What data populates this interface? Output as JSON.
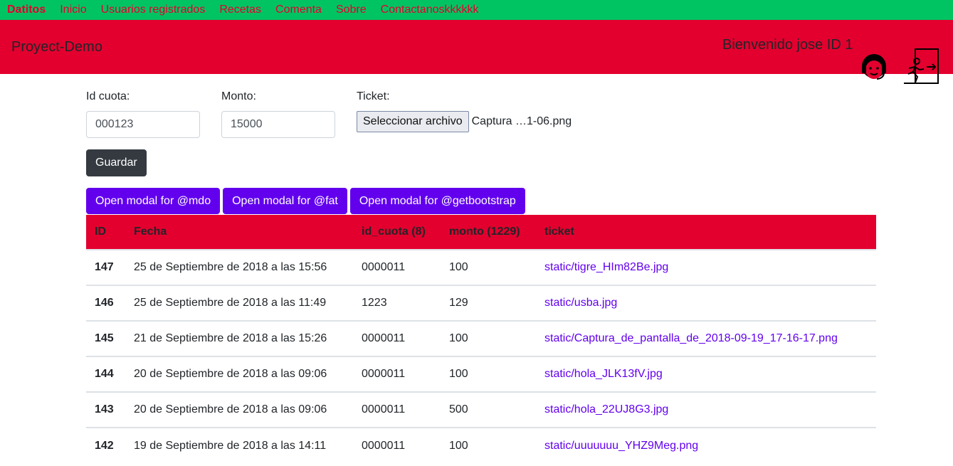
{
  "nav": {
    "brand": "Datitos",
    "links": [
      "Inicio",
      "Usuarios registrados",
      "Recetas",
      "Comenta",
      "Sobre",
      "Contactanoskkkkkk"
    ]
  },
  "header": {
    "title": "Proyect-Demo",
    "welcome": "Bienvenido jose ID 1"
  },
  "form": {
    "id_cuota": {
      "label": "Id cuota:",
      "value": "000123"
    },
    "monto": {
      "label": "Monto:",
      "value": "15000"
    },
    "ticket": {
      "label": "Ticket:",
      "button": "Seleccionar archivo",
      "file": "Captura …1-06.png"
    },
    "save": "Guardar"
  },
  "modals": [
    "Open modal for @mdo",
    "Open modal for @fat",
    "Open modal for @getbootstrap"
  ],
  "table": {
    "headers": [
      "ID",
      "Fecha",
      "id_cuota (8)",
      "monto (1229)",
      "ticket"
    ],
    "rows": [
      [
        "147",
        "25 de Septiembre de 2018 a las 15:56",
        "0000011",
        "100",
        "static/tigre_HIm82Be.jpg"
      ],
      [
        "146",
        "25 de Septiembre de 2018 a las 11:49",
        "1223",
        "129",
        "static/usba.jpg"
      ],
      [
        "145",
        "21 de Septiembre de 2018 a las 15:26",
        "0000011",
        "100",
        "static/Captura_de_pantalla_de_2018-09-19_17-16-17.png"
      ],
      [
        "144",
        "20 de Septiembre de 2018 a las 09:06",
        "0000011",
        "100",
        "static/hola_JLK13fV.jpg"
      ],
      [
        "143",
        "20 de Septiembre de 2018 a las 09:06",
        "0000011",
        "500",
        "static/hola_22UJ8G3.jpg"
      ],
      [
        "142",
        "19 de Septiembre de 2018 a las 14:11",
        "0000011",
        "100",
        "static/uuuuuuu_YHZ9Meg.png"
      ]
    ]
  },
  "colors": {
    "nav_bg": "#00c462",
    "header_bg": "#e3002e",
    "accent": "#6200ee"
  }
}
